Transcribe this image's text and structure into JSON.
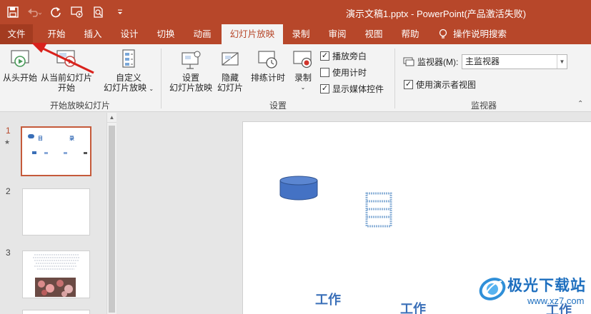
{
  "window": {
    "title": "演示文稿1.pptx - PowerPoint(产品激活失败)"
  },
  "tabs": [
    {
      "label": "文件"
    },
    {
      "label": "开始"
    },
    {
      "label": "插入"
    },
    {
      "label": "设计"
    },
    {
      "label": "切换"
    },
    {
      "label": "动画"
    },
    {
      "label": "幻灯片放映"
    },
    {
      "label": "录制"
    },
    {
      "label": "审阅"
    },
    {
      "label": "视图"
    },
    {
      "label": "帮助"
    }
  ],
  "tell_me": "操作说明搜索",
  "ribbon": {
    "group_start": {
      "label": "开始放映幻灯片",
      "from_beginning": "从头开始",
      "from_current_1": "从当前幻灯片",
      "from_current_2": "开始",
      "custom_1": "自定义",
      "custom_2": "幻灯片放映"
    },
    "group_setup": {
      "label": "设置",
      "setup_1": "设置",
      "setup_2": "幻灯片放映",
      "hide_1": "隐藏",
      "hide_2": "幻灯片",
      "rehearse": "排练计时",
      "record": "录制",
      "play_narrations": "播放旁白",
      "use_timings": "使用计时",
      "show_media_controls": "显示媒体控件",
      "play_narrations_checked": true,
      "use_timings_checked": false,
      "show_media_controls_checked": true
    },
    "group_monitors": {
      "label": "监视器",
      "monitor_label": "监视器(M):",
      "monitor_value": "主监视器",
      "presenter_view": "使用演示者视图",
      "presenter_view_checked": true
    }
  },
  "thumbnails": [
    {
      "number": "1",
      "star": "★",
      "title_left": "目",
      "title_right": "录"
    },
    {
      "number": "2"
    },
    {
      "number": "3"
    }
  ],
  "slide_words": [
    "工作",
    "工作",
    "工作"
  ],
  "watermark": {
    "name": "极光下载站",
    "url": "www.xz7.com"
  },
  "colors": {
    "accent": "#b7472a",
    "blue": "#3a6fb8"
  }
}
